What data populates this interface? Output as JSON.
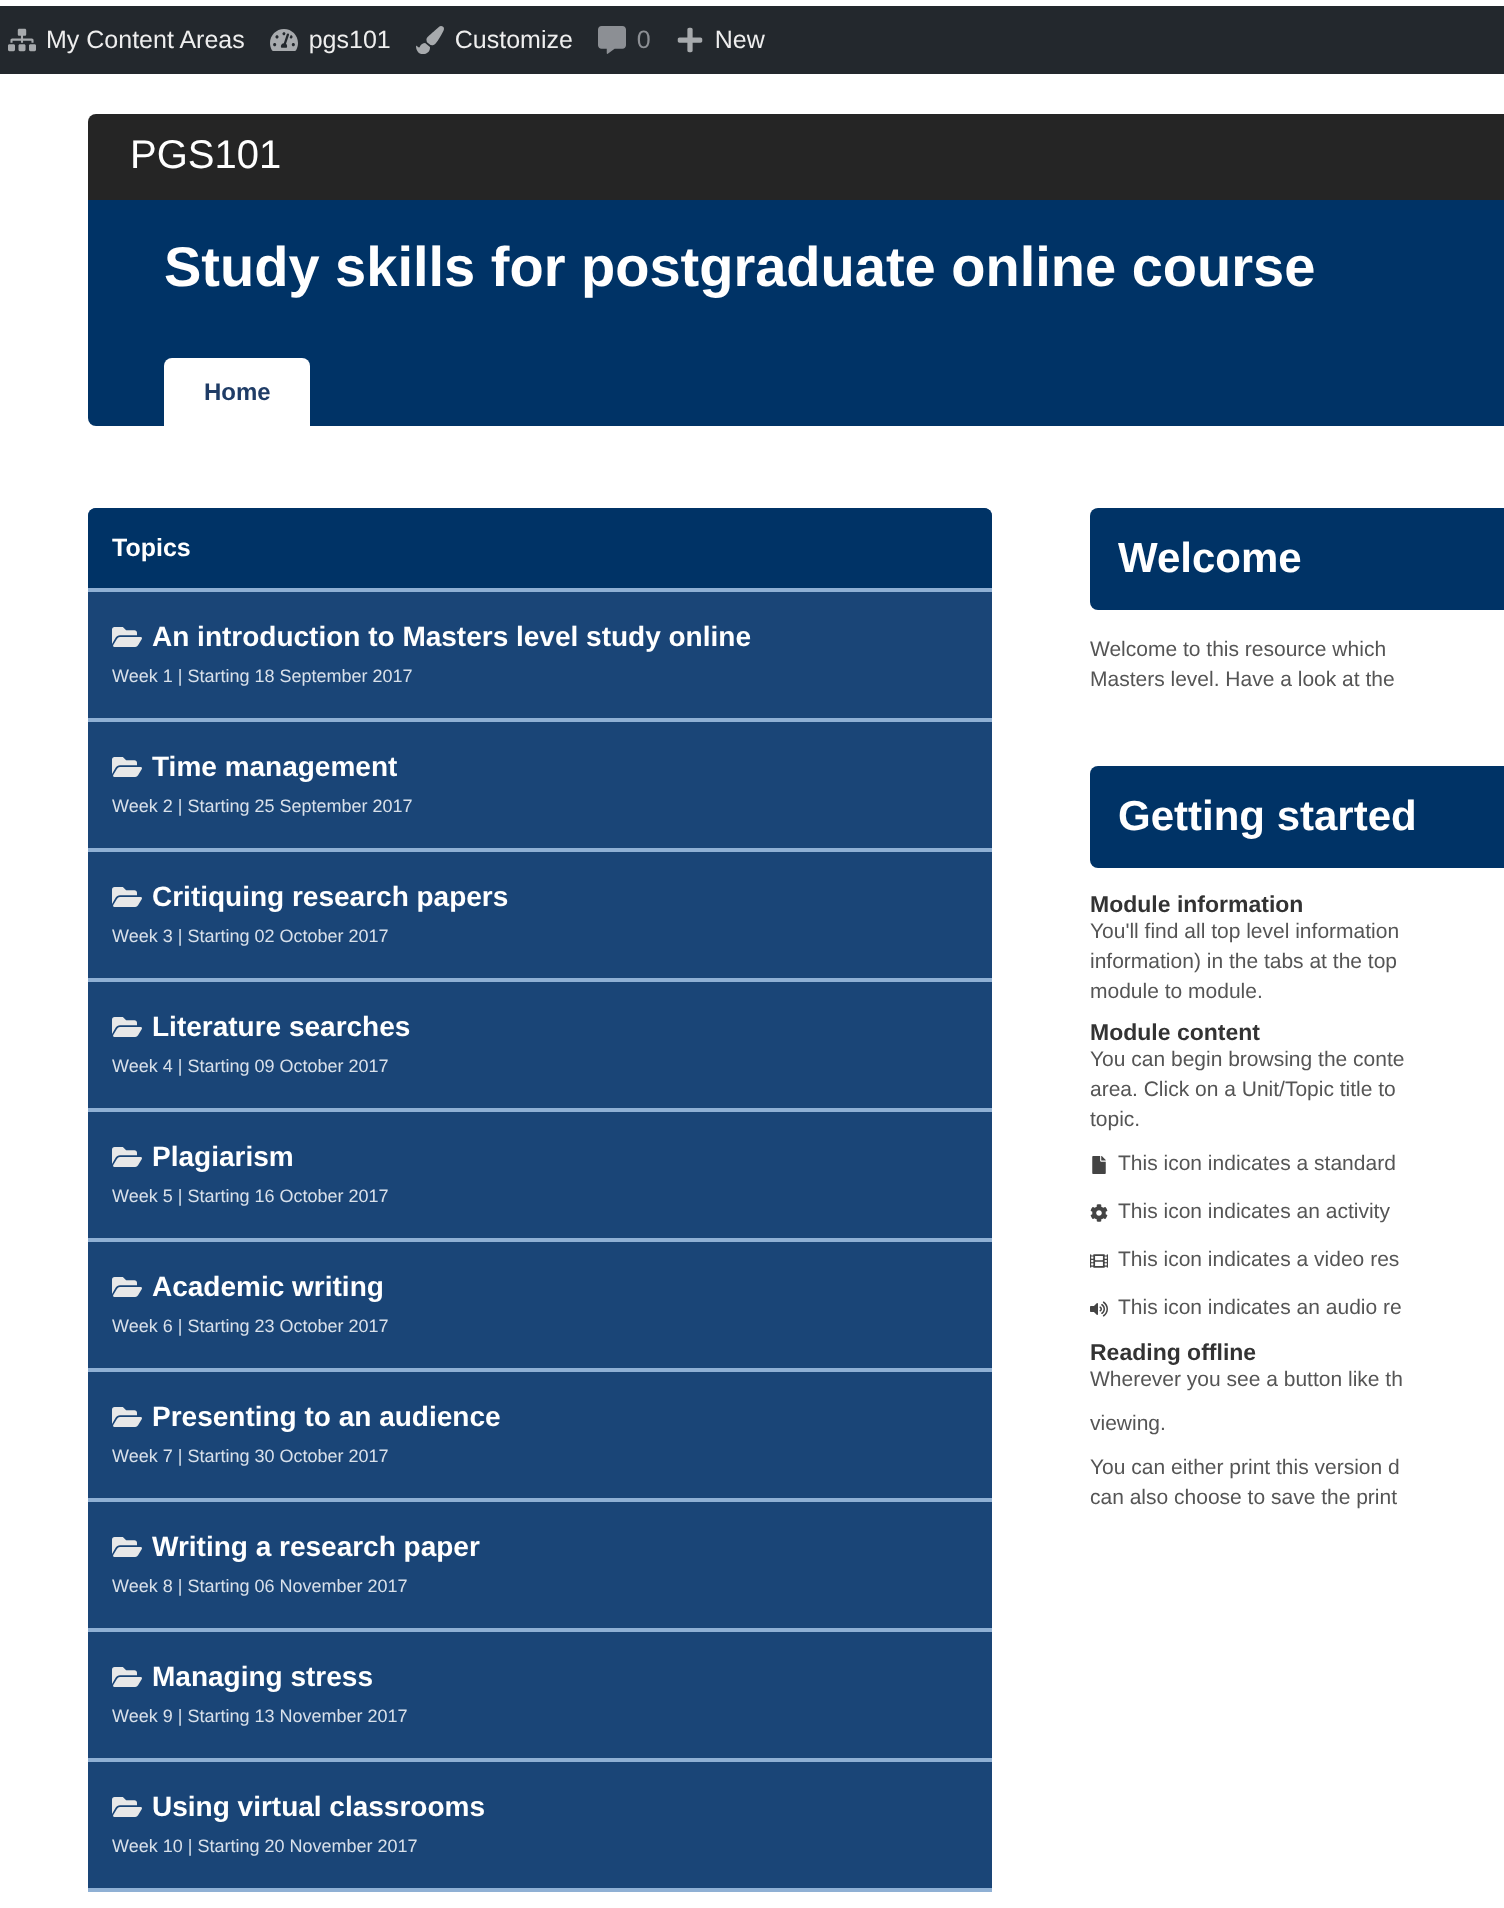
{
  "admin_bar": [
    {
      "kind": "home",
      "label": "My Content Areas"
    },
    {
      "kind": "dashboard",
      "label": "pgs101"
    },
    {
      "kind": "brush",
      "label": "Customize"
    },
    {
      "kind": "comment",
      "label": "0"
    },
    {
      "kind": "plus",
      "label": "New"
    }
  ],
  "site": {
    "code": "PGS101",
    "title": "Study skills for postgraduate online course"
  },
  "tabs": [
    {
      "label": "Home",
      "selected": true
    }
  ],
  "topics": {
    "title": "Topics",
    "items": [
      {
        "title": "An introduction to Masters level study online",
        "subtitle": "Week 1 | Starting 18 September 2017"
      },
      {
        "title": "Time management",
        "subtitle": "Week 2 | Starting 25 September 2017"
      },
      {
        "title": "Critiquing research papers",
        "subtitle": "Week 3 | Starting 02 October 2017"
      },
      {
        "title": "Literature searches",
        "subtitle": "Week 4 | Starting 09 October 2017"
      },
      {
        "title": "Plagiarism",
        "subtitle": "Week 5 | Starting 16 October 2017"
      },
      {
        "title": "Academic writing",
        "subtitle": "Week 6 | Starting 23 October 2017"
      },
      {
        "title": "Presenting to an audience",
        "subtitle": "Week 7 | Starting 30 October 2017"
      },
      {
        "title": "Writing a research paper",
        "subtitle": "Week 8 | Starting 06 November 2017"
      },
      {
        "title": "Managing stress",
        "subtitle": "Week 9 | Starting 13 November 2017"
      },
      {
        "title": "Using virtual classrooms",
        "subtitle": "Week 10 | Starting 20 November 2017"
      }
    ]
  },
  "sections": [
    {
      "heading": "Welcome",
      "blocks": [
        {
          "kind": "para",
          "lines": [
            "Welcome to this resource which",
            "Masters level. Have a look at the"
          ]
        }
      ]
    },
    {
      "heading": "Getting started",
      "blocks": [
        {
          "kind": "subhead",
          "text": "Module information"
        },
        {
          "kind": "para",
          "lines": [
            "You'll find all top level information",
            "information) in the tabs at the top",
            "module to module."
          ]
        },
        {
          "kind": "subhead",
          "text": "Module content"
        },
        {
          "kind": "para",
          "lines": [
            "You can begin browsing the conte",
            "area. Click on a Unit/Topic title to",
            "topic."
          ]
        },
        {
          "kind": "file",
          "text": "This icon indicates a standard"
        },
        {
          "kind": "gear",
          "text": "This icon indicates an activity"
        },
        {
          "kind": "film",
          "text": "This icon indicates a video res"
        },
        {
          "kind": "audio",
          "text": "This icon indicates an audio re"
        },
        {
          "kind": "subhead",
          "text": "Reading offline"
        },
        {
          "kind": "para",
          "lines": [
            "Wherever you see a button like th"
          ]
        },
        {
          "kind": "para",
          "lines": [
            "viewing."
          ]
        },
        {
          "kind": "para",
          "lines": [
            "You can either print this version d",
            "can also choose to save the print"
          ]
        }
      ]
    }
  ]
}
